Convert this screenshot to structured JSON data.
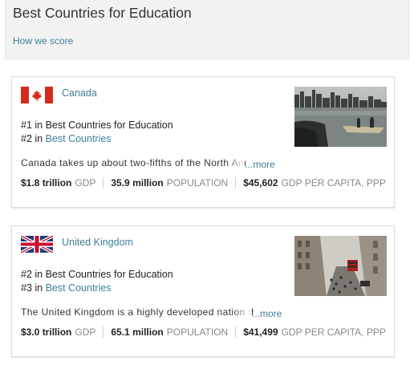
{
  "header": {
    "title": "Best Countries for Education",
    "how_link": "How we score"
  },
  "countries": [
    {
      "name": "Canada",
      "rank_primary": "#1 in Best Countries for Education",
      "rank_secondary_prefix": "#2 in ",
      "rank_secondary_link": "Best Countries",
      "description": "Canada takes up about two-fifths of the North Am",
      "more": "...more",
      "gdp_value": "$1.8 trillion",
      "gdp_label": "GDP",
      "population_value": "35.9 million",
      "population_label": "POPULATION",
      "gdp_pc_value": "$45,602",
      "gdp_pc_label": "GDP PER CAPITA, PPP"
    },
    {
      "name": "United Kingdom",
      "rank_primary": "#2 in Best Countries for Education",
      "rank_secondary_prefix": "#3 in ",
      "rank_secondary_link": "Best Countries",
      "description": "The United Kingdom is a highly developed nation tha",
      "more": "...more",
      "gdp_value": "$3.0 trillion",
      "gdp_label": "GDP",
      "population_value": "65.1 million",
      "population_label": "POPULATION",
      "gdp_pc_value": "$41,499",
      "gdp_pc_label": "GDP PER CAPITA, PPP"
    }
  ],
  "colors": {
    "link": "#3f7f9a",
    "header_bg": "#f2f2f2"
  }
}
